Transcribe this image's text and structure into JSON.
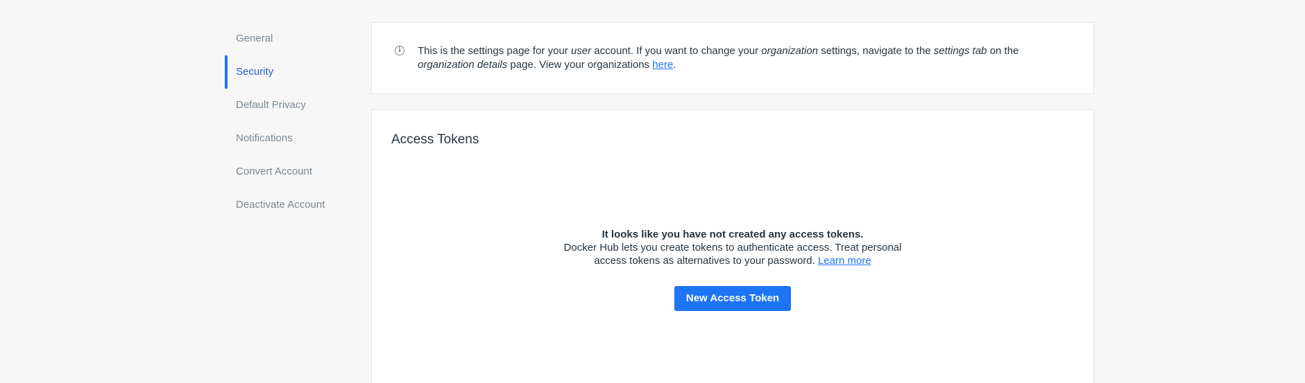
{
  "sidebar": {
    "items": [
      {
        "label": "General"
      },
      {
        "label": "Security"
      },
      {
        "label": "Default Privacy"
      },
      {
        "label": "Notifications"
      },
      {
        "label": "Convert Account"
      },
      {
        "label": "Deactivate Account"
      }
    ],
    "active": "Security"
  },
  "info": {
    "icon": "info-icon",
    "t1": "This is the settings page for your ",
    "t2": "user",
    "t3": " account. If you want to change your ",
    "t4": "organization",
    "t5": " settings, navigate to the ",
    "t6": "settings tab",
    "t7": " on the ",
    "t8": "organization details",
    "t9": " page. View your organizations ",
    "link": "here",
    "t10": "."
  },
  "tokens": {
    "title": "Access Tokens",
    "empty_heading": "It looks like you have not created any access tokens.",
    "empty_desc": "Docker Hub lets you create tokens to authenticate access. Treat personal access tokens as alternatives to your password. ",
    "learn_more": "Learn more",
    "new_button": "New Access Token"
  },
  "colors": {
    "accent": "#1d74f5",
    "background": "#f7f7f7",
    "text": "#27343f",
    "muted": "#7a8791"
  }
}
